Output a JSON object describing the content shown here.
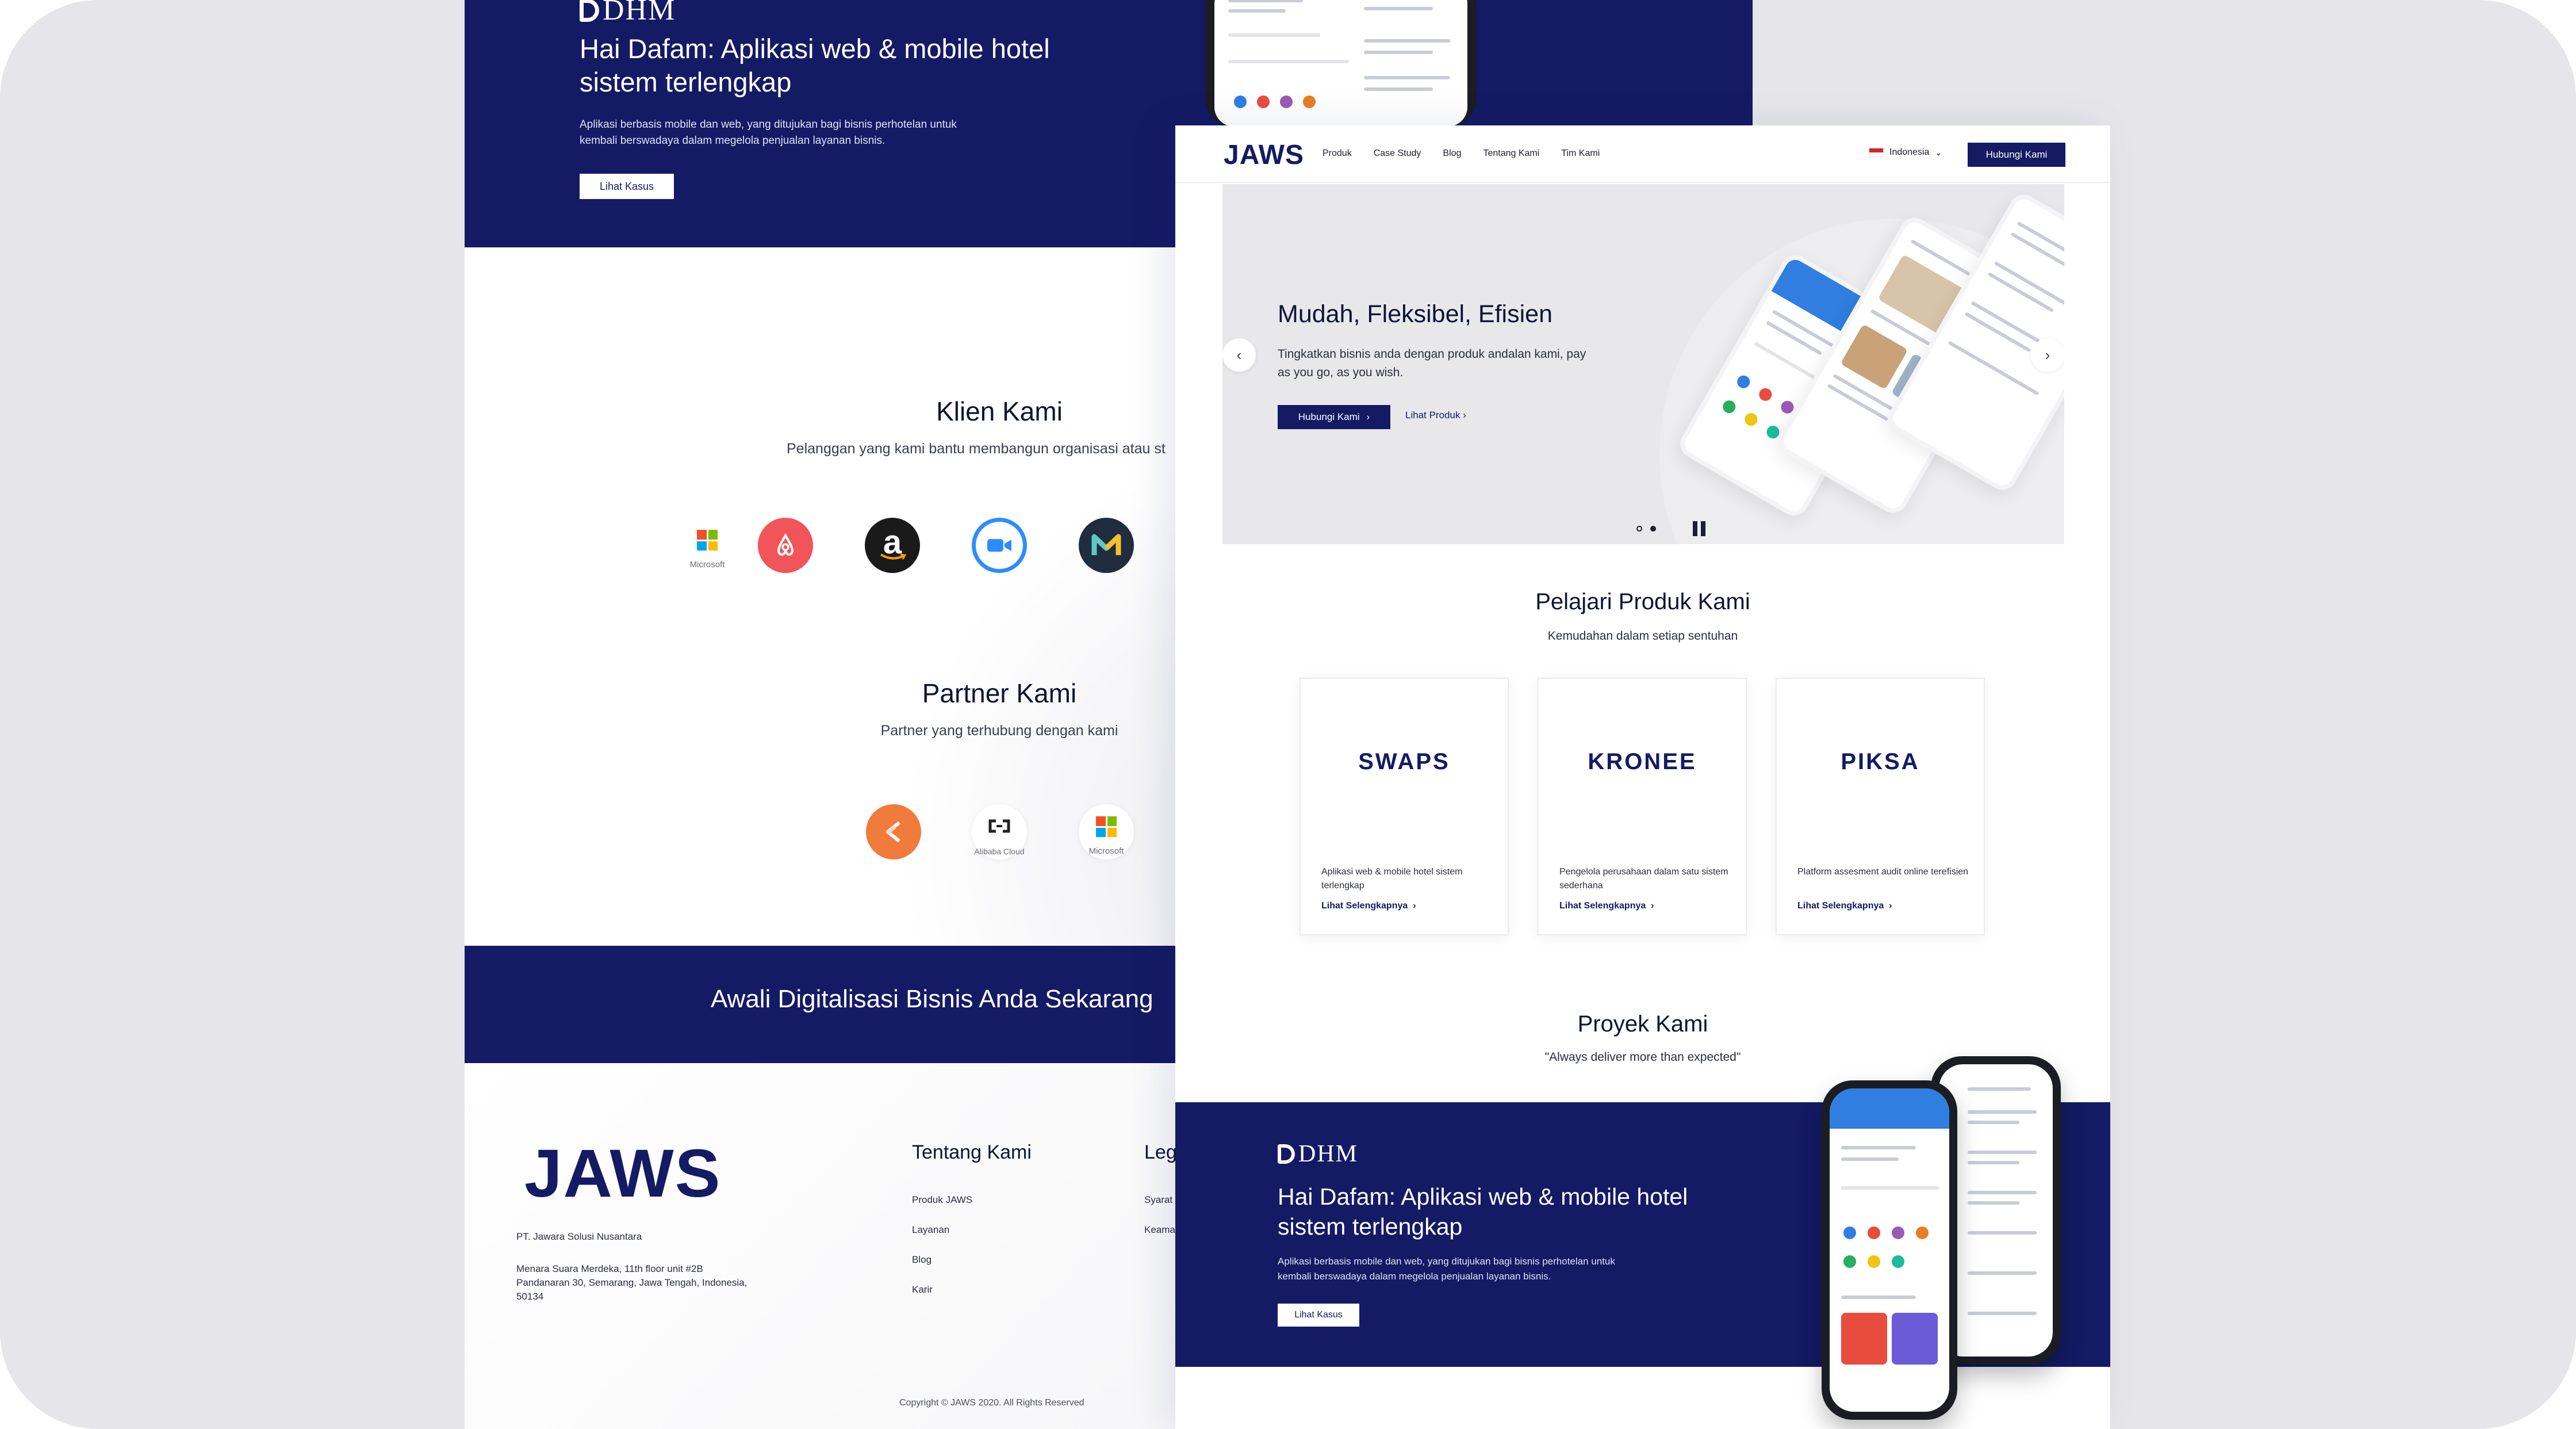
{
  "back": {
    "hero": {
      "brand": "DHM",
      "title": "Hai Dafam: Aplikasi web & mobile hotel sistem terlengkap",
      "desc": "Aplikasi berbasis mobile dan web, yang ditujukan bagi bisnis perhotelan untuk kembali berswadaya dalam megelola penjualan layanan bisnis.",
      "button": "Lihat Kasus"
    },
    "clients": {
      "title": "Klien Kami",
      "subtitle": "Pelanggan yang kami bantu membangun organisasi atau st",
      "logos": [
        {
          "name": "Microsoft",
          "label": "Microsoft"
        },
        {
          "name": "Airbnb",
          "color": "#f1555a"
        },
        {
          "name": "Amazon",
          "color": "#1a1a1a"
        },
        {
          "name": "Zoom",
          "color": "#2d8cff"
        },
        {
          "name": "Mendeley",
          "color": "#1f2d3f"
        }
      ]
    },
    "partners": {
      "title": "Partner Kami",
      "subtitle": "Partner yang terhubung dengan kami",
      "logos": [
        {
          "name": "Kotlin",
          "color": "#f07b3b"
        },
        {
          "name": "Alibaba Cloud",
          "label": "Alibaba Cloud"
        },
        {
          "name": "Microsoft",
          "label": "Microsoft"
        }
      ]
    },
    "cta": "Awali Digitalisasi Bisnis Anda Sekarang",
    "footer": {
      "logo": "JAWS",
      "company": "PT. Jawara Solusi Nusantara",
      "address": "Menara Suara Merdeka, 11th floor unit #2B Pandanaran 30, Semarang, Jawa Tengah, Indonesia, 50134",
      "col1_title": "Tentang Kami",
      "col1_links": [
        "Produk JAWS",
        "Layanan",
        "Blog",
        "Karir"
      ],
      "col2_title": "Leg",
      "col2_links": [
        "Syarat",
        "Keama"
      ],
      "copyright": "Copyright © JAWS 2020.  All Rights Reserved"
    }
  },
  "front": {
    "nav": {
      "logo": "JAWS",
      "menu": [
        "Produk",
        "Case Study",
        "Blog",
        "Tentang Kami",
        "Tim Kami"
      ],
      "language": "Indonesia",
      "cta": "Hubungi Kami"
    },
    "hero": {
      "title": "Mudah, Fleksibel, Efisien",
      "desc": "Tingkatkan bisnis anda dengan produk andalan kami, pay as you go, as you wish.",
      "primary": "Hubungi Kami",
      "secondary": "Lihat Produk",
      "slide_index": 2,
      "slide_count": 2
    },
    "products": {
      "title": "Pelajari Produk Kami",
      "subtitle": "Kemudahan dalam setiap sentuhan",
      "items": [
        {
          "logo": "SWAPS",
          "desc": "Aplikasi web & mobile hotel sistem terlengkap",
          "link": "Lihat Selengkapnya"
        },
        {
          "logo": "KRONEE",
          "desc": "Pengelola perusahaan dalam satu sistem sederhana",
          "link": "Lihat Selengkapnya"
        },
        {
          "logo": "PIKSA",
          "desc": "Platform assesment audit online terefisien",
          "link": "Lihat Selengkapnya"
        }
      ]
    },
    "projects": {
      "title": "Proyek Kami",
      "subtitle": "\"Always deliver more than expected\"",
      "brand": "DHM",
      "heading": "Hai Dafam: Aplikasi web & mobile hotel sistem terlengkap",
      "desc": "Aplikasi berbasis mobile dan web, yang ditujukan bagi bisnis perhotelan untuk kembali berswadaya dalam megelola penjualan layanan bisnis.",
      "button": "Lihat Kasus"
    }
  },
  "colors": {
    "navy": "#141a63",
    "background": "#e6e6ea"
  }
}
